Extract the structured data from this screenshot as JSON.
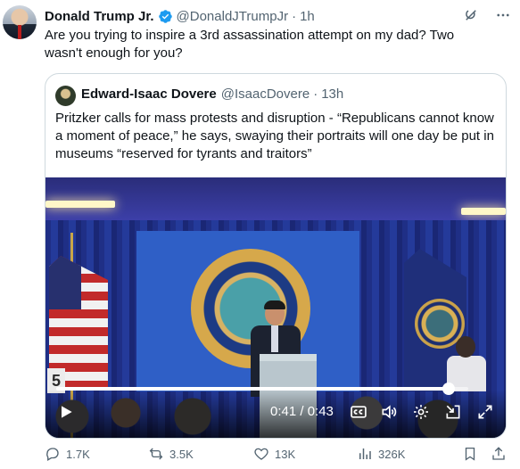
{
  "tweet": {
    "author_name": "Donald Trump Jr.",
    "handle": "@DonaldJTrumpJr",
    "separator": "·",
    "time": "1h",
    "text": "Are you trying to inspire a 3rd assassination attempt on my dad? Two wasn't enough for you?"
  },
  "quote": {
    "author_name": "Edward-Isaac Dovere",
    "handle": "@IsaacDovere",
    "separator": "·",
    "time": "13h",
    "text": "Pritzker calls for mass protests and disruption - “Republicans cannot know a moment of peace,” he says, swaying their portraits will one day be put in museums “reserved for tyrants and traitors”"
  },
  "video": {
    "timecode": "0:41 / 0:43",
    "progress_fraction": 0.953,
    "podium_sign_text": "5"
  },
  "actions": {
    "replies": "1.7K",
    "reposts": "3.5K",
    "likes": "13K",
    "views": "326K"
  },
  "icons": {
    "verified": "verified-badge-icon",
    "grok": "grok-icon",
    "more": "more-options-icon",
    "play": "play-icon",
    "captions": "closed-captions-icon",
    "volume": "volume-icon",
    "settings": "gear-icon",
    "minimize": "minimize-icon",
    "fullscreen": "fullscreen-icon",
    "reply": "reply-icon",
    "repost": "repost-icon",
    "like": "heart-icon",
    "views": "views-icon",
    "bookmark": "bookmark-icon",
    "share": "share-icon"
  },
  "colors": {
    "text_primary": "#0f1419",
    "text_secondary": "#536471",
    "verified_blue": "#1d9bf0",
    "border": "#cfd9de"
  }
}
